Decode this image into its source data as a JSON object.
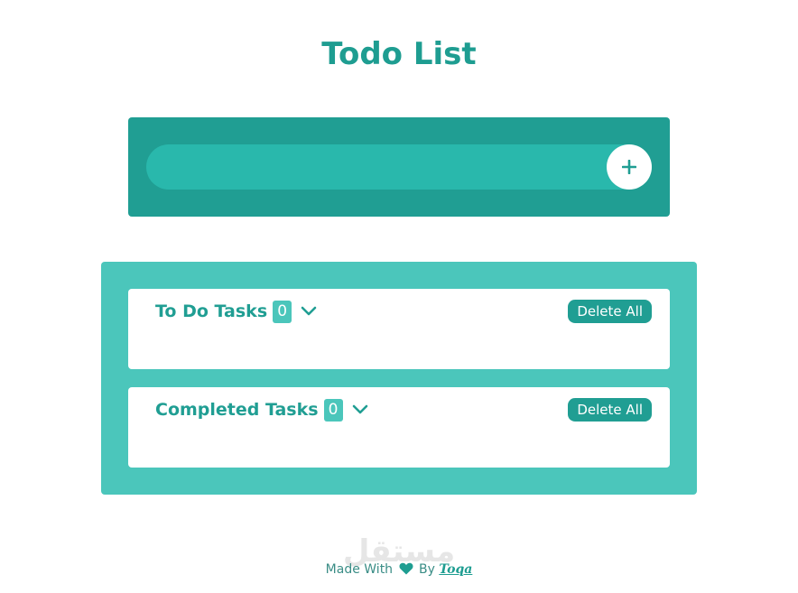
{
  "header": {
    "title": "Todo List"
  },
  "add_task": {
    "placeholder": "",
    "value": "",
    "button_label": "+"
  },
  "lists": [
    {
      "title": "To Do Tasks",
      "count": "0",
      "delete_label": "Delete All",
      "icon": "chevron-down-icon"
    },
    {
      "title": "Completed Tasks",
      "count": "0",
      "delete_label": "Delete All",
      "icon": "chevron-down-icon"
    }
  ],
  "footer": {
    "prefix": "Made With",
    "middle": "By",
    "author": "Toqa",
    "icon": "heart-icon",
    "watermark": "مستقل"
  },
  "colors": {
    "primary": "#209e93",
    "panel_light": "#4bc6bb",
    "input_fill": "#29b8ac",
    "background": "#ffffff"
  }
}
